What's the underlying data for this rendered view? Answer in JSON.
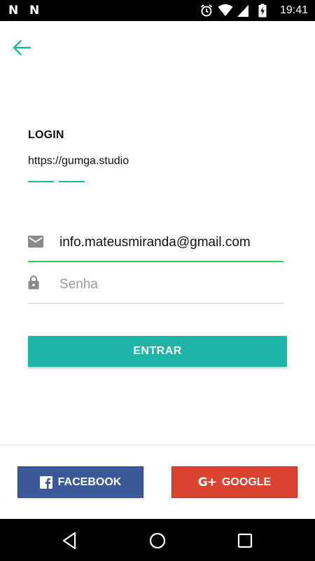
{
  "status_bar": {
    "time": "19:41",
    "notif_icon_1": "N",
    "notif_icon_2": "N",
    "icons": [
      "alarm-icon",
      "wifi-icon",
      "signal-icon",
      "battery-charging-icon"
    ]
  },
  "header": {
    "back_icon": "arrow-left-icon"
  },
  "login": {
    "title": "LOGIN",
    "url": "https://gumga.studio"
  },
  "form": {
    "email_value": "info.mateusmiranda@gmail.com",
    "email_icon": "email-icon",
    "password_placeholder": "Senha",
    "password_icon": "lock-icon",
    "submit_label": "ENTRAR"
  },
  "social": {
    "facebook_label": "FACEBOOK",
    "google_label": "GOOGLE",
    "google_icon_text": "G+"
  },
  "colors": {
    "accent": "#1eb4a7",
    "email_underline": "#29d04e",
    "facebook": "#3b5998",
    "google": "#d9432f"
  }
}
